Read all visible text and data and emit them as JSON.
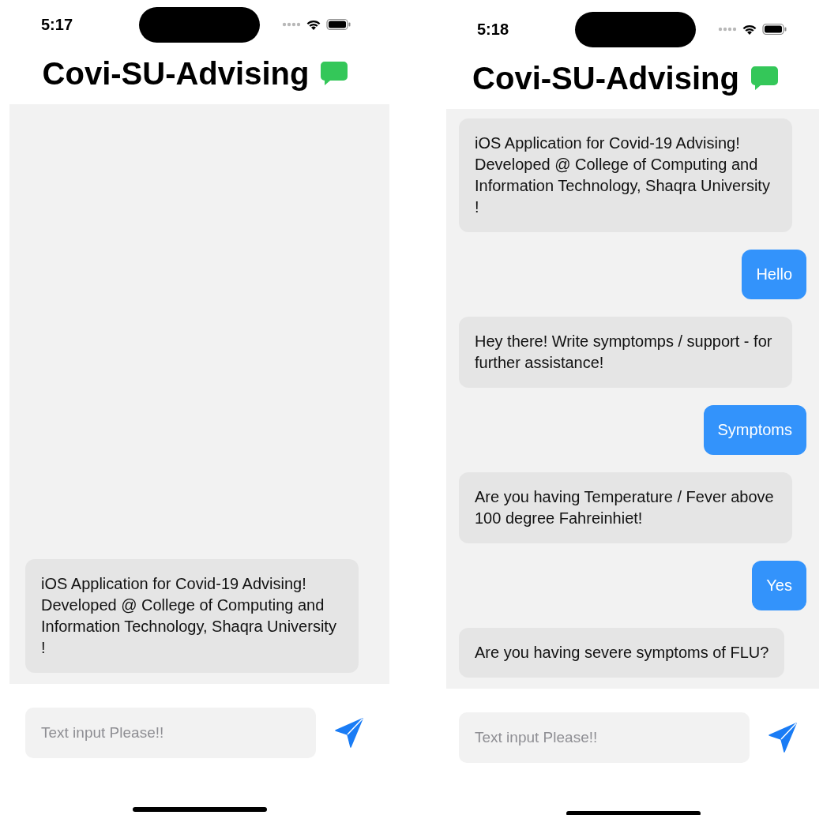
{
  "screens": [
    {
      "time": "5:17",
      "title": "Covi-SU-Advising",
      "messages": [
        {
          "kind": "received",
          "text": "iOS Application for Covid-19 Advising! Developed @ College of Computing and Information Technology, Shaqra University !"
        }
      ],
      "input": {
        "placeholder": "Text input Please!!"
      }
    },
    {
      "time": "5:18",
      "title": "Covi-SU-Advising",
      "messages": [
        {
          "kind": "received",
          "text": "iOS Application for Covid-19 Advising! Developed @ College of Computing and Information Technology, Shaqra University !"
        },
        {
          "kind": "sent",
          "text": "Hello"
        },
        {
          "kind": "received",
          "text": "Hey there! Write symptomps / support - for further assistance!"
        },
        {
          "kind": "sent",
          "text": "Symptoms"
        },
        {
          "kind": "received",
          "text": "Are you having Temperature / Fever above 100 degree Fahreinhiet!"
        },
        {
          "kind": "sent",
          "text": "Yes"
        },
        {
          "kind": "received",
          "text": "Are you having severe symptoms of FLU?"
        }
      ],
      "input": {
        "placeholder": "Text input Please!!"
      }
    }
  ]
}
